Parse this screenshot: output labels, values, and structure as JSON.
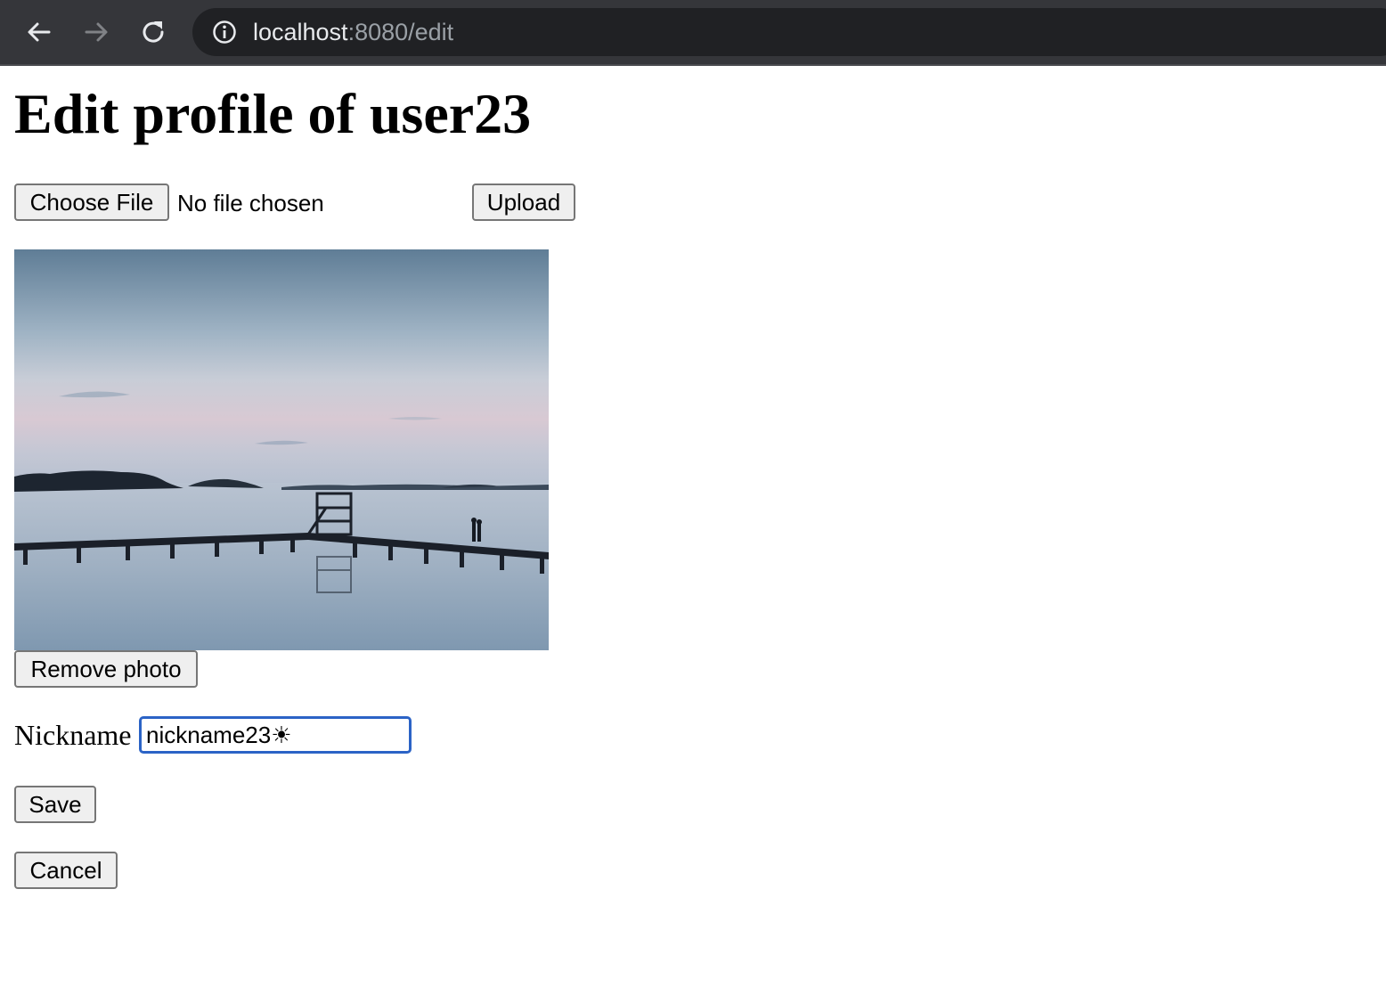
{
  "browser": {
    "url_host": "localhost",
    "url_path": ":8080/edit",
    "icons": {
      "back": "arrow-left-icon",
      "forward": "arrow-right-icon",
      "reload": "reload-icon",
      "site_info": "info-icon"
    }
  },
  "page": {
    "title": "Edit profile of user23",
    "file_input": {
      "button_label": "Choose File",
      "status": "No file chosen"
    },
    "upload_label": "Upload",
    "remove_photo_label": "Remove photo",
    "nickname": {
      "label": "Nickname",
      "value": "nickname23☀"
    },
    "save_label": "Save",
    "cancel_label": "Cancel"
  }
}
